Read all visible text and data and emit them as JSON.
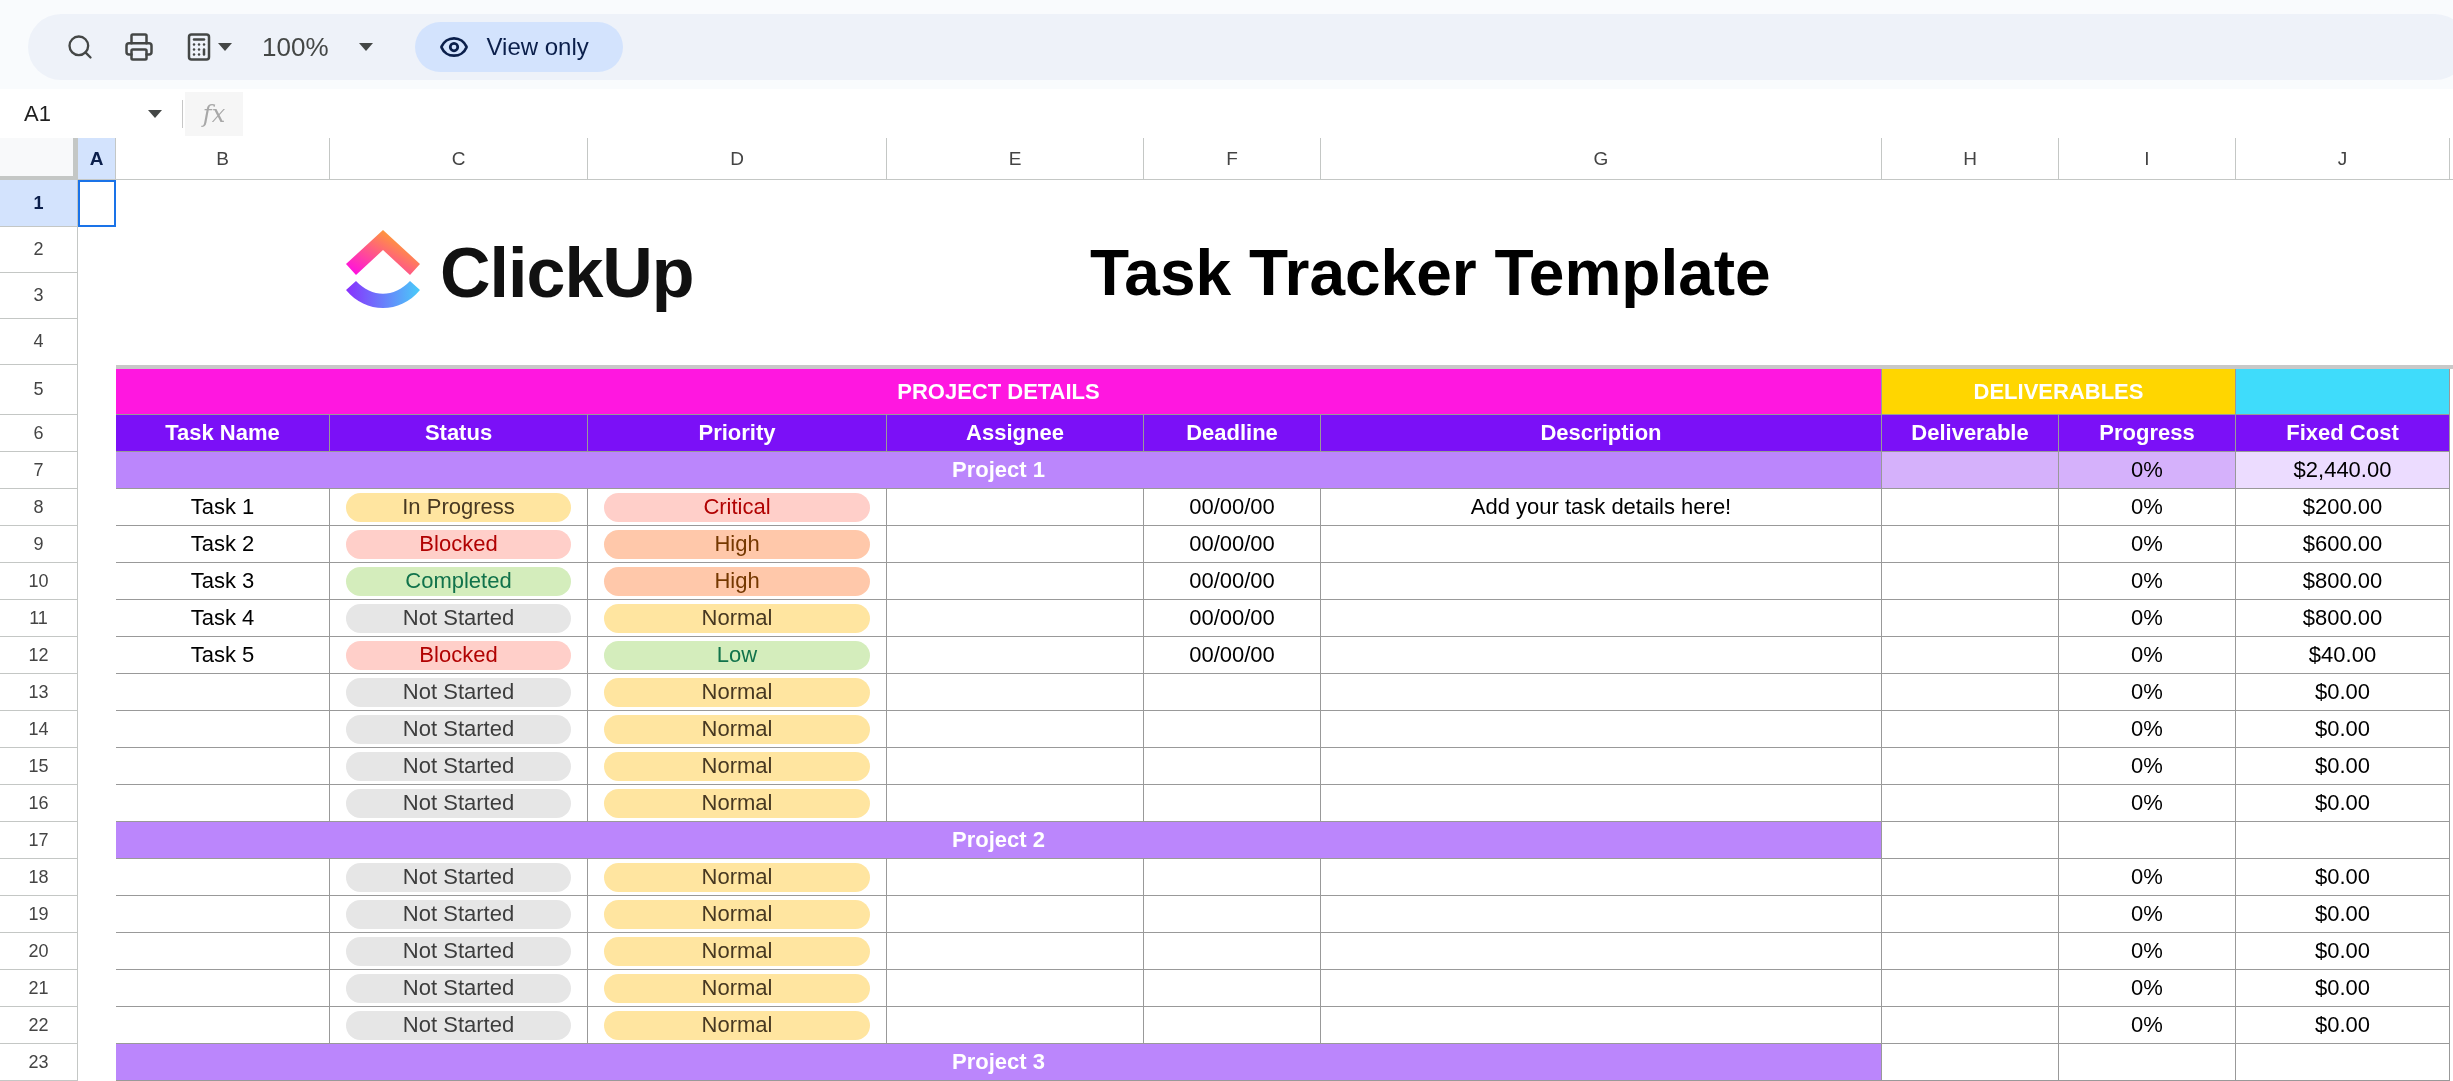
{
  "toolbar": {
    "zoom": "100%",
    "view_mode": "View only"
  },
  "formula_bar": {
    "name_box": "A1",
    "fx_label": "fx"
  },
  "column_headers": [
    {
      "label": "A",
      "selected": true
    },
    {
      "label": "B",
      "selected": false
    },
    {
      "label": "C",
      "selected": false
    },
    {
      "label": "D",
      "selected": false
    },
    {
      "label": "E",
      "selected": false
    },
    {
      "label": "F",
      "selected": false
    },
    {
      "label": "G",
      "selected": false
    },
    {
      "label": "H",
      "selected": false
    },
    {
      "label": "I",
      "selected": false
    },
    {
      "label": "J",
      "selected": false
    }
  ],
  "row_headers": [
    {
      "label": "1",
      "selected": true
    },
    {
      "label": "2",
      "selected": false
    },
    {
      "label": "3",
      "selected": false
    },
    {
      "label": "4",
      "selected": false
    },
    {
      "label": "5",
      "selected": false
    },
    {
      "label": "6",
      "selected": false
    },
    {
      "label": "7",
      "selected": false
    },
    {
      "label": "8",
      "selected": false
    },
    {
      "label": "9",
      "selected": false
    },
    {
      "label": "10",
      "selected": false
    },
    {
      "label": "11",
      "selected": false
    },
    {
      "label": "12",
      "selected": false
    },
    {
      "label": "13",
      "selected": false
    },
    {
      "label": "14",
      "selected": false
    },
    {
      "label": "15",
      "selected": false
    },
    {
      "label": "16",
      "selected": false
    },
    {
      "label": "17",
      "selected": false
    },
    {
      "label": "18",
      "selected": false
    },
    {
      "label": "19",
      "selected": false
    },
    {
      "label": "20",
      "selected": false
    },
    {
      "label": "21",
      "selected": false
    },
    {
      "label": "22",
      "selected": false
    },
    {
      "label": "23",
      "selected": false
    }
  ],
  "banner": {
    "logo_text": "ClickUp",
    "title": "Task Tracker Template"
  },
  "table": {
    "groups": [
      {
        "label": "PROJECT DETAILS",
        "color": "#ff17e0"
      },
      {
        "label": "DELIVERABLES",
        "color": "#ffd600"
      },
      {
        "color": "#3fdcfb"
      }
    ],
    "columns": [
      "Task Name",
      "Status",
      "Priority",
      "Assignee",
      "Deadline",
      "Description",
      "Deliverable",
      "Progress",
      "Fixed Cost"
    ],
    "sections": [
      {
        "title": "Project 1",
        "progress": "0%",
        "fixed_cost": "$2,440.00",
        "rows": [
          {
            "task": "Task 1",
            "status": {
              "label": "In Progress",
              "color": "#ffe5a0"
            },
            "priority": {
              "label": "Critical",
              "color": "#ffcfc9"
            },
            "deadline": "00/00/00",
            "description": "Add your task details here!",
            "progress": "0%",
            "fixed_cost": "$200.00"
          },
          {
            "task": "Task 2",
            "status": {
              "label": "Blocked",
              "color": "#ffcfc9"
            },
            "priority": {
              "label": "High",
              "color": "#ffc8aa"
            },
            "deadline": "00/00/00",
            "progress": "0%",
            "fixed_cost": "$600.00"
          },
          {
            "task": "Task 3",
            "status": {
              "label": "Completed",
              "color": "#d4edbc"
            },
            "priority": {
              "label": "High",
              "color": "#ffc8aa"
            },
            "deadline": "00/00/00",
            "progress": "0%",
            "fixed_cost": "$800.00"
          },
          {
            "task": "Task 4",
            "status": {
              "label": "Not Started",
              "color": "#e6e6e6"
            },
            "priority": {
              "label": "Normal",
              "color": "#ffe5a0"
            },
            "deadline": "00/00/00",
            "progress": "0%",
            "fixed_cost": "$800.00"
          },
          {
            "task": "Task 5",
            "status": {
              "label": "Blocked",
              "color": "#ffcfc9"
            },
            "priority": {
              "label": "Low",
              "color": "#d4edbc"
            },
            "deadline": "00/00/00",
            "progress": "0%",
            "fixed_cost": "$40.00"
          },
          {
            "status": {
              "label": "Not Started",
              "color": "#e6e6e6"
            },
            "priority": {
              "label": "Normal",
              "color": "#ffe5a0"
            },
            "progress": "0%",
            "fixed_cost": "$0.00"
          },
          {
            "status": {
              "label": "Not Started",
              "color": "#e6e6e6"
            },
            "priority": {
              "label": "Normal",
              "color": "#ffe5a0"
            },
            "progress": "0%",
            "fixed_cost": "$0.00"
          },
          {
            "status": {
              "label": "Not Started",
              "color": "#e6e6e6"
            },
            "priority": {
              "label": "Normal",
              "color": "#ffe5a0"
            },
            "progress": "0%",
            "fixed_cost": "$0.00"
          },
          {
            "status": {
              "label": "Not Started",
              "color": "#e6e6e6"
            },
            "priority": {
              "label": "Normal",
              "color": "#ffe5a0"
            },
            "progress": "0%",
            "fixed_cost": "$0.00"
          }
        ]
      },
      {
        "title": "Project 2",
        "rows": [
          {
            "status": {
              "label": "Not Started",
              "color": "#e6e6e6"
            },
            "priority": {
              "label": "Normal",
              "color": "#ffe5a0"
            },
            "progress": "0%",
            "fixed_cost": "$0.00"
          },
          {
            "status": {
              "label": "Not Started",
              "color": "#e6e6e6"
            },
            "priority": {
              "label": "Normal",
              "color": "#ffe5a0"
            },
            "progress": "0%",
            "fixed_cost": "$0.00"
          },
          {
            "status": {
              "label": "Not Started",
              "color": "#e6e6e6"
            },
            "priority": {
              "label": "Normal",
              "color": "#ffe5a0"
            },
            "progress": "0%",
            "fixed_cost": "$0.00"
          },
          {
            "status": {
              "label": "Not Started",
              "color": "#e6e6e6"
            },
            "priority": {
              "label": "Normal",
              "color": "#ffe5a0"
            },
            "progress": "0%",
            "fixed_cost": "$0.00"
          },
          {
            "status": {
              "label": "Not Started",
              "color": "#e6e6e6"
            },
            "priority": {
              "label": "Normal",
              "color": "#ffe5a0"
            },
            "progress": "0%",
            "fixed_cost": "$0.00"
          }
        ]
      },
      {
        "title": "Project 3"
      }
    ]
  }
}
